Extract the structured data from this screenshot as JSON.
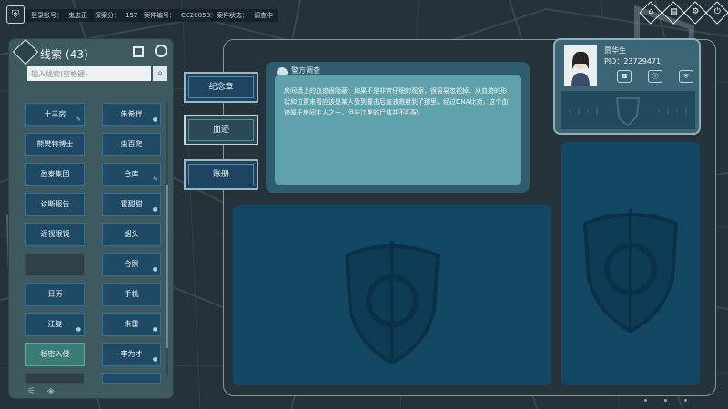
{
  "status": {
    "login_label": "登录账号：",
    "login_value": "鬼忠正",
    "score_label": "探案分：",
    "score_value": "157",
    "case_label": "案件编号：",
    "case_value": "CC200505",
    "state_label": "案件状态：",
    "state_value": "调查中"
  },
  "top_icons": [
    "home-icon",
    "case-file-icon",
    "settings-icon",
    "exit-icon"
  ],
  "clues": {
    "title": "线索",
    "count": "(43)",
    "search_placeholder": "输入线索(空格键)",
    "items": [
      "十三房",
      "朱希祥",
      "熊樊特博士",
      "虫百爬",
      "盈泰集团",
      "仓库",
      "诊断报告",
      "霍甜甜",
      "近视眼镜",
      "烟头",
      "",
      "合照",
      "日历",
      "手机",
      "江复",
      "朱雷",
      "秘密入侵",
      "李为才"
    ]
  },
  "tabs": [
    "纪念章",
    "血迹",
    "账册"
  ],
  "detail": {
    "heading": "警方调查",
    "body": "房间墙上的血迹很隐蔽，如果不是非常仔细的观察，很容易忽视掉。从血迹的形状和位置来看应该是某人受到撞击后血液溅射到了那里。经过DNA比对，这个血迹属于房间主人之一，但与江里的尸体并不匹配。"
  },
  "profile": {
    "name": "贾华生",
    "pid_label": "PID：",
    "pid_value": "23729471"
  },
  "colors": {
    "accent": "#1e4a66",
    "selected": "#3c7c76",
    "card": "#5fa2ab",
    "border": "#7b9aa3"
  }
}
